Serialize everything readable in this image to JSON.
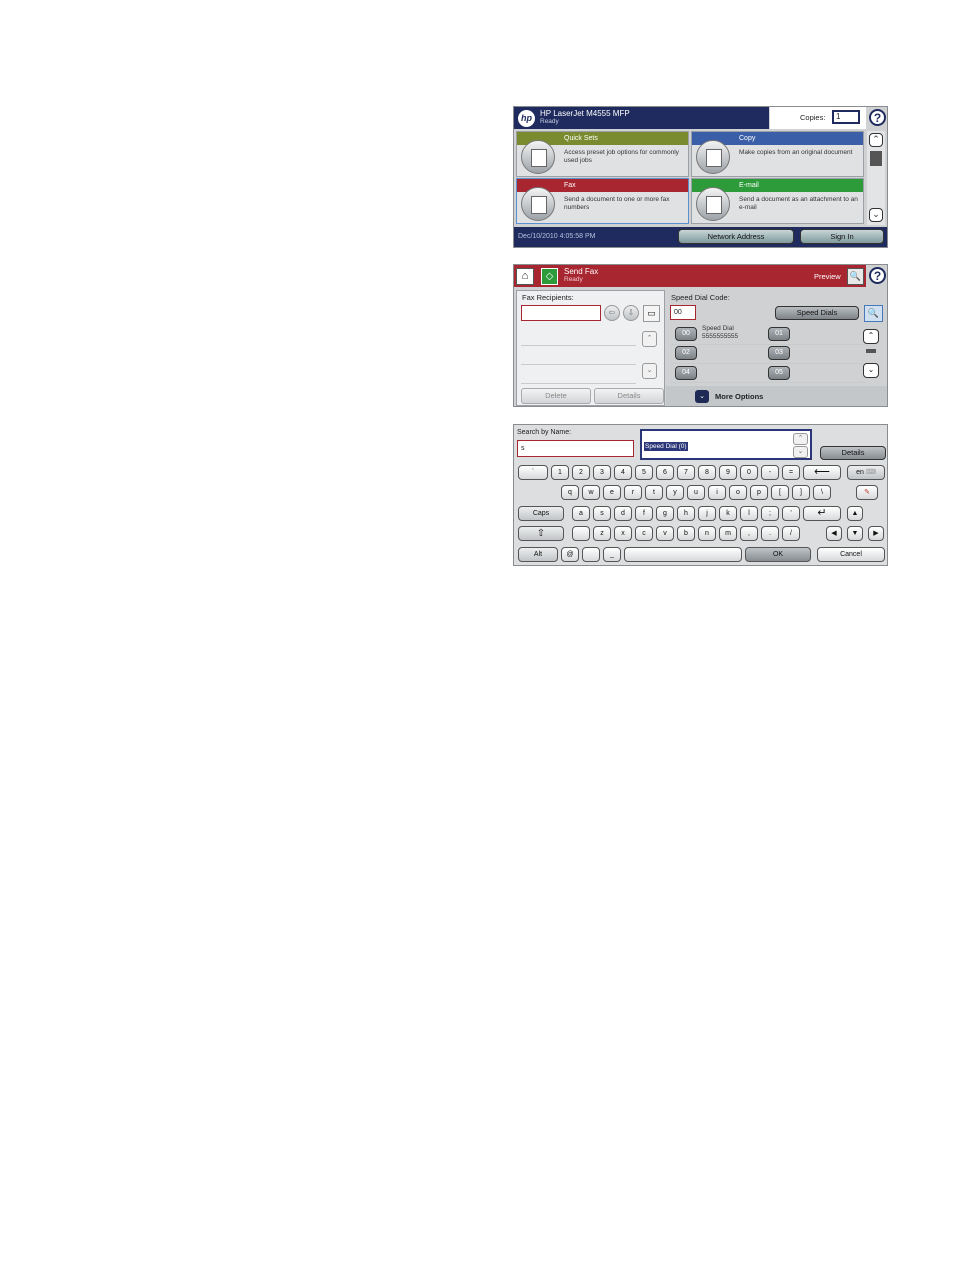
{
  "home": {
    "brand": "hp",
    "title": "HP LaserJet M4555 MFP",
    "status": "Ready",
    "copies_label": "Copies:",
    "copies_value": "1",
    "help_icon": "?",
    "tiles": [
      {
        "label": "Quick Sets",
        "desc": "Access preset job options for commonly used jobs",
        "color": "#7a8a2e"
      },
      {
        "label": "Copy",
        "desc": "Make copies from an original document",
        "color": "#3b5ea8"
      },
      {
        "label": "Fax",
        "desc": "Send a document to one or more fax numbers",
        "color": "#a7262f"
      },
      {
        "label": "E-mail",
        "desc": "Send a document as an attachment to an e-mail",
        "color": "#2e9b3b"
      }
    ],
    "datetime": "Dec/10/2010 4:05:58 PM",
    "network_button": "Network Address",
    "signin_button": "Sign In"
  },
  "fax": {
    "home_icon": "⌂",
    "title": "Send Fax",
    "status": "Ready",
    "preview_label": "Preview",
    "recipients_label": "Fax Recipients:",
    "delete_button": "Delete",
    "details_button": "Details",
    "speed_dial_label": "Speed Dial Code:",
    "speed_dial_value": "00",
    "speed_dials_button": "Speed Dials",
    "codes": [
      "00",
      "01",
      "02",
      "03",
      "04",
      "05"
    ],
    "first_entry_name": "Speed Dial",
    "first_entry_number": "5555555555",
    "more_options": "More Options"
  },
  "keyboard": {
    "search_label": "Search by Name:",
    "search_value": "s",
    "result_selected": "Speed Dial (0)",
    "details_button": "Details",
    "row1": [
      "`",
      "1",
      "2",
      "3",
      "4",
      "5",
      "6",
      "7",
      "8",
      "9",
      "0",
      "-",
      "="
    ],
    "lang_key": "en",
    "row2": [
      "q",
      "w",
      "e",
      "r",
      "t",
      "y",
      "u",
      "i",
      "o",
      "p",
      "[",
      "]",
      "\\"
    ],
    "caps_key": "Caps",
    "row3": [
      "a",
      "s",
      "d",
      "f",
      "g",
      "h",
      "j",
      "k",
      "l",
      ";",
      "'"
    ],
    "row4": [
      "",
      "z",
      "x",
      "c",
      "v",
      "b",
      "n",
      "m",
      ",",
      ".",
      "/"
    ],
    "alt_key": "Alt",
    "at_key": "@",
    "underscore_key": "_",
    "ok_button": "OK",
    "cancel_button": "Cancel"
  }
}
